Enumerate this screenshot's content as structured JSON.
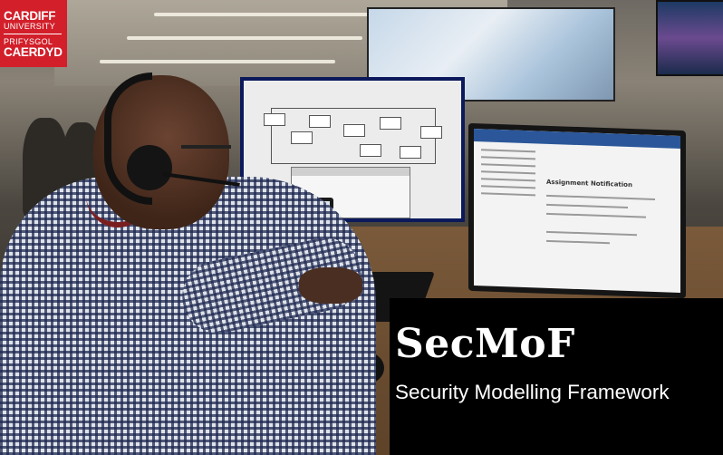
{
  "logo": {
    "line1": "CARDIFF",
    "line2": "UNIVERSITY",
    "line3": "PRIFYSGOL",
    "line4": "CAERDYD",
    "color": "#d21f2a"
  },
  "banner": {
    "title": "SecMoF",
    "subtitle": "Security Modelling Framework",
    "background": "#000000",
    "text_color": "#ffffff"
  },
  "screens": {
    "email_heading": "Assignment Notification"
  }
}
